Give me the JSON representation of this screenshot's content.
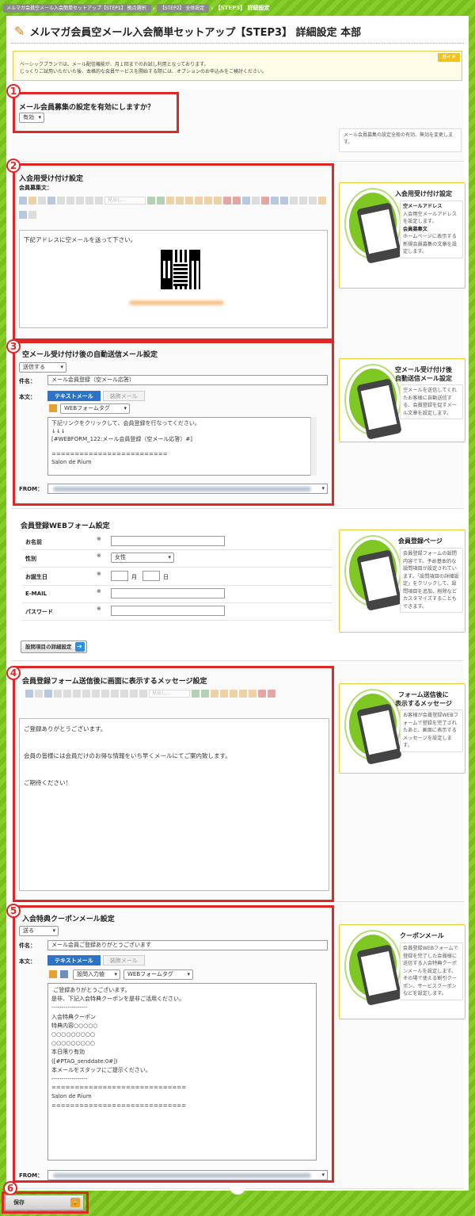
{
  "breadcrumb": {
    "step1": "メルマガ会員空メール入会簡単セットアップ【STEP1】 拠点選択",
    "step2": "【STEP2】 全体設定",
    "step3": "【STEP3】 詳細設定"
  },
  "page_title": "メルマガ会員空メール入会簡単セットアップ【STEP3】 詳細設定 本部",
  "guide": {
    "tag": "ガイド",
    "line1": "ベーシックプランでは、メール配信機能が、月１回までのお試し利用となっております。",
    "line2": "じっくりご試用いただいた後、本格的な会員サービスを開始する際には、オプションのお申込みをご検討ください。"
  },
  "section1": {
    "num": "1",
    "title": "メール会員募集の設定を有効にしますか？",
    "select": "有効",
    "note": "メール会員募集の設定全般の有効、無効を変更します。"
  },
  "section2": {
    "num": "2",
    "title": "入会用受け付け設定",
    "label": "会員募集文：",
    "editor_text": "下記アドレスに空メールを送って下さい。",
    "toolbar_select": "見出し...",
    "side": {
      "title": "入会用受け付け設定",
      "h1": "空メールアドレス",
      "d1": "入会用空メールアドレスを設定します。",
      "h2": "会員募集文",
      "d2": "ホームページに表示する新規会員募集の文章を設定します。"
    }
  },
  "section3": {
    "num": "3",
    "title": "空メール受け付け後の自動送信メール設定",
    "send_select": "送信する",
    "subject_label": "件名：",
    "subject": "メール会員登録（空メール応答）",
    "body_label": "本文：",
    "tab_text": "テキストメール",
    "tab_deco": "装飾メール",
    "tag_select": "WEBフォームタグ",
    "body": "下記リンクをクリックして、会員登録を行なってください。\n↓↓↓\n[#WEBFORM_122:メール会員登録（空メール応答）#]\n\n=========================\nSalon de Rium",
    "from_label": "FROM：",
    "side": {
      "title": "空メール受け付け後\n自動送信メール設定",
      "desc": "空メールを送信してくれたお客様に自動送信する、会員登録を促すメール文章を設定します。"
    }
  },
  "webform": {
    "title": "会員登録WEBフォーム設定",
    "rows": [
      {
        "label": "お名前",
        "req": "※"
      },
      {
        "label": "性別",
        "req": "※",
        "select": "女性"
      },
      {
        "label": "お誕生日",
        "req": "※",
        "month": "月",
        "day": "日"
      },
      {
        "label": "E-MAIL",
        "req": "※"
      },
      {
        "label": "パスワード",
        "req": "※"
      }
    ],
    "detail_button": "設問項目の詳細設定",
    "side": {
      "title": "会員登録ページ",
      "desc": "会員登録フォームの設問内容です。予め基本的な設問項目が設定されています。「設問項目の詳細設定」をクリックして、設問項目を追加、削除などカスタマイズすることもできます。"
    }
  },
  "section4": {
    "num": "4",
    "title": "会員登録フォーム送信後に画面に表示するメッセージ設定",
    "toolbar_select": "見出し...",
    "line1": "ご登録ありがとうございます。",
    "line2": "会員の皆様には会員だけのお得な情報をいち早くメールにてご案内致します。",
    "line3": "ご期待ください！",
    "side": {
      "title": "フォーム送信後に\n表示するメッセージ",
      "desc": "お客様が会員登録WEBフォームで登録を完了されたあと、画面に表示するメッセージを設定します。"
    }
  },
  "section5": {
    "num": "5",
    "title": "入会特典クーポンメール設定",
    "send_select": "送る",
    "subject_label": "件名：",
    "subject": "メール会員ご登録ありがとうございます",
    "body_label": "本文：",
    "tab_text": "テキストメール",
    "tab_deco": "装飾メール",
    "input_select": "設問入力値",
    "tag_select": "WEBフォームタグ",
    "body": " ご登録ありがとうございます。\n是非、下記入会特典クーポンを是非ご活用ください。\n------------------\n入会特典クーポン\n特典内容○○○○○\n○○○○○○○○○\n○○○○○○○○○\n本日限り有効\n([#PTAG_senddate:0#])\n本メールをスタッフにご提示ください。\n------------------\n=============================\nSalon de Rium\n=============================",
    "from_label": "FROM：",
    "side": {
      "title": "クーポンメール",
      "desc": "会員登録WEBフォームで登録を完了した会員様に送信する入会特典クーポンメールを設定します。その場で使える割引クーポン、サービスクーポンなどを設定します。"
    }
  },
  "section6": {
    "num": "6",
    "save": "保存"
  },
  "colors": {
    "accent_green": "#7fc823",
    "highlight_red": "#e12626",
    "tab_blue": "#2d72c9",
    "guide_yellow": "#f2c21b"
  }
}
